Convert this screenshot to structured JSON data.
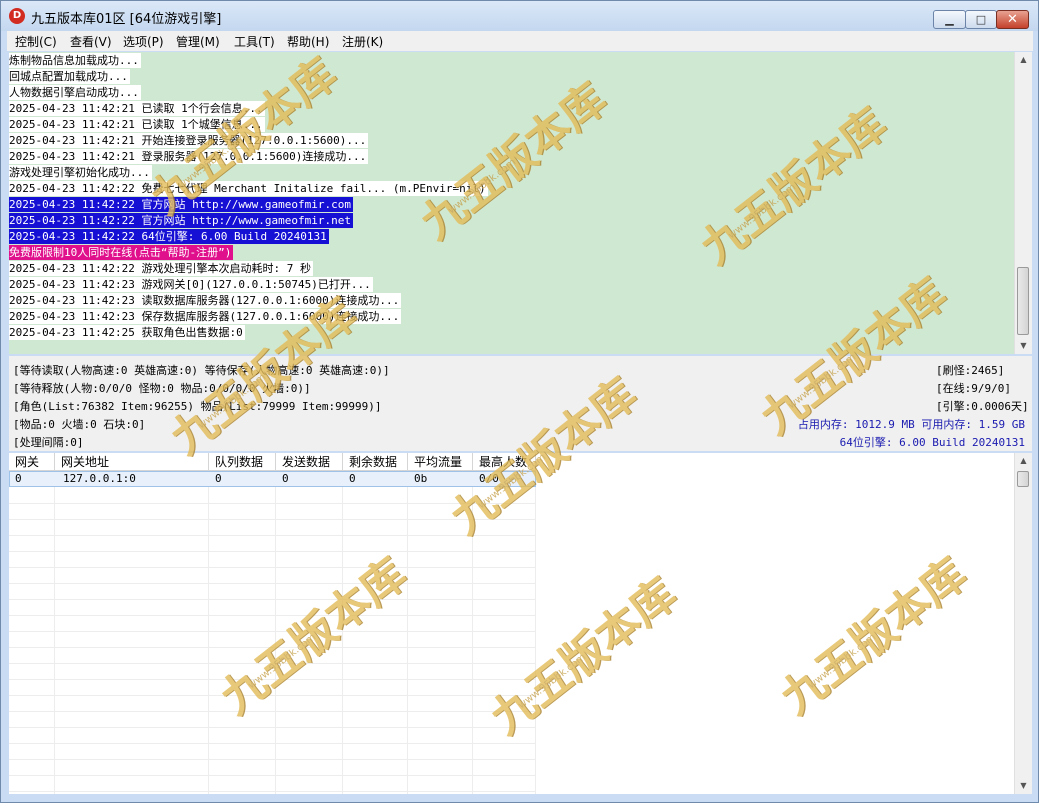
{
  "window": {
    "title": "九五版本库01区 [64位游戏引擎]",
    "icon_letter": "D"
  },
  "menu": [
    "控制(C)",
    "查看(V)",
    "选项(P)",
    "管理(M)",
    "工具(T)",
    "帮助(H)",
    "注册(K)"
  ],
  "log_lines": [
    {
      "text": "炼制物品信息加载成功...",
      "style": "normal"
    },
    {
      "text": "回城点配置加载成功...",
      "style": "normal"
    },
    {
      "text": "人物数据引擎启动成功...",
      "style": "normal"
    },
    {
      "text": "2025-04-23 11:42:21 已读取 1个行会信息...",
      "style": "normal"
    },
    {
      "text": "2025-04-23 11:42:21 已读取 1个城堡信息...",
      "style": "normal"
    },
    {
      "text": "2025-04-23 11:42:21 开始连接登录服务器(127.0.0.1:5600)...",
      "style": "normal"
    },
    {
      "text": "2025-04-23 11:42:21 登录服务器(127.0.0.1:5600)连接成功...",
      "style": "normal"
    },
    {
      "text": "游戏处理引擎初始化成功...",
      "style": "normal"
    },
    {
      "text": "2025-04-23 11:42:22 免费七七代理 Merchant Initalize fail... (m.PEnvir=nil)",
      "style": "normal"
    },
    {
      "text": "2025-04-23 11:42:22 官方网站 http://www.gameofmir.com",
      "style": "blue"
    },
    {
      "text": "2025-04-23 11:42:22 官方网站 http://www.gameofmir.net",
      "style": "blue"
    },
    {
      "text": "2025-04-23 11:42:22 64位引擎: 6.00 Build 20240131",
      "style": "blue"
    },
    {
      "text": "免费版限制10人同时在线(点击“帮助-注册”)",
      "style": "pink"
    },
    {
      "text": "2025-04-23 11:42:22 游戏处理引擎本次启动耗时: 7 秒",
      "style": "normal"
    },
    {
      "text": "2025-04-23 11:42:23 游戏网关[0](127.0.0.1:50745)已打开...",
      "style": "normal"
    },
    {
      "text": "2025-04-23 11:42:23 读取数据库服务器(127.0.0.1:6000)连接成功...",
      "style": "normal"
    },
    {
      "text": "2025-04-23 11:42:23 保存数据库服务器(127.0.0.1:6000)连接成功...",
      "style": "normal"
    },
    {
      "text": "2025-04-23 11:42:25 获取角色出售数据:0",
      "style": "normal"
    }
  ],
  "status": {
    "left": [
      "[等待读取(人物高速:0 英雄高速:0) 等待保存(人物高速:0 英雄高速:0)]",
      "[等待释放(人物:0/0/0 怪物:0 物品:0/0/0/0 火墙:0)]",
      "[角色(List:76382 Item:96255) 物品(List:79999 Item:99999)]",
      "[物品:0 火墙:0 石块:0]",
      "[处理间隔:0]"
    ],
    "right": [
      "[刷怪:2465]",
      "[在线:9/9/0]",
      "[引擎:0.0006天]"
    ],
    "memory": "占用内存: 1012.9 MB 可用内存: 1.59 GB",
    "engine": "64位引擎: 6.00 Build 20240131"
  },
  "table": {
    "headers": [
      "网关",
      "网关地址",
      "队列数据",
      "发送数据",
      "剩余数据",
      "平均流量",
      "最高人数"
    ],
    "rows": [
      [
        "0",
        "127.0.0.1:0",
        "0",
        "0",
        "0",
        "0b",
        "0/0"
      ]
    ]
  },
  "watermark": {
    "brand": "九五版本库",
    "url": "www.95bbk.com"
  },
  "colors": {
    "log_bg": "#cfe8d2",
    "highlight_blue": "#1610d4",
    "highlight_pink": "#e00f8c",
    "status_blue": "#1a1ab0"
  }
}
